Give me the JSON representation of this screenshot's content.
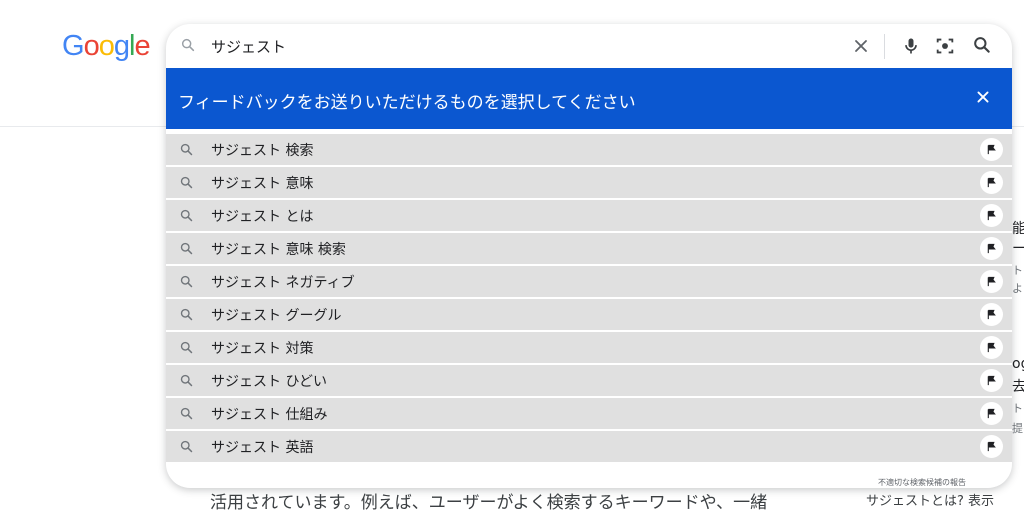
{
  "logo": {
    "letters": [
      "G",
      "o",
      "o",
      "g",
      "l",
      "e"
    ],
    "colors": [
      "#4285f4",
      "#ea4335",
      "#fbbc05",
      "#4285f4",
      "#34a853",
      "#ea4335"
    ]
  },
  "search": {
    "query": "サジェスト"
  },
  "feedback": {
    "banner_text": "フィードバックをお送りいただけるものを選択してください",
    "banner_color": "#0b57d0"
  },
  "suggestions": [
    "サジェスト 検索",
    "サジェスト 意味",
    "サジェスト とは",
    "サジェスト 意味 検索",
    "サジェスト ネガティブ",
    "サジェスト グーグル",
    "サジェスト 対策",
    "サジェスト ひどい",
    "サジェスト 仕組み",
    "サジェスト 英語"
  ],
  "report_link": "不適切な検索候補の報告",
  "background": {
    "bottom_text": "活用されています。例えば、ユーザーがよく検索するキーワードや、一緒",
    "bottom_right_text": "サジェストとは? 表示",
    "fragments": [
      "能の",
      "ール",
      "トの",
      "よ",
      "og",
      "去を",
      "トの",
      "提"
    ]
  }
}
